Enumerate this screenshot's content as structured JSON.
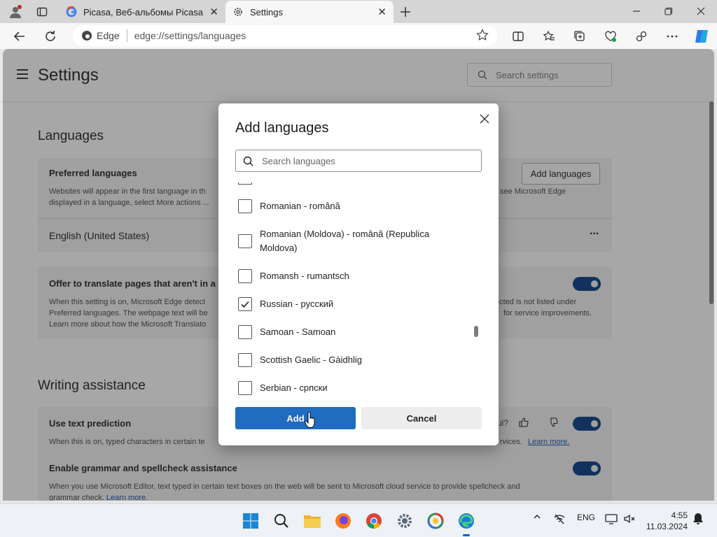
{
  "tabs": [
    {
      "title": "Picasa, Веб-альбомы Picasa и Al"
    },
    {
      "title": "Settings"
    }
  ],
  "address": {
    "site_label": "Edge",
    "url": "edge://settings/languages"
  },
  "settings": {
    "title": "Settings",
    "search_placeholder": "Search settings",
    "languages_heading": "Languages",
    "preferred": {
      "title": "Preferred languages",
      "desc_line1": "Websites will appear in the first language in th",
      "desc_line1b": "see Microsoft Edge",
      "desc_line2": "displayed in a language, select More actions ...",
      "add_button": "Add languages",
      "language": "English (United States)",
      "more": "..."
    },
    "translate": {
      "title": "Offer to translate pages that aren't in a",
      "line1": "When this setting is on, Microsoft Edge detect",
      "line1b": "ected is not listed under",
      "line2": "Preferred languages. The webpage text will be",
      "line2b": "for service improvements.",
      "line3": "Learn more about how the Microsoft Translato"
    },
    "writing_heading": "Writing assistance",
    "prediction": {
      "title": "Use text prediction",
      "question_tail": "ul?",
      "desc": "When this is on, typed characters in certain te",
      "desc_tail": "rvices.",
      "learn_more": "Learn more."
    },
    "grammar": {
      "title": "Enable grammar and spellcheck assistance",
      "line1": "When you use Microsoft Editor, text typed in certain text boxes on the web will be sent to Microsoft cloud service to provide spellcheck and",
      "line2": "grammar check.",
      "learn_more": "Learn more."
    }
  },
  "dialog": {
    "title": "Add languages",
    "search_placeholder": "Search languages",
    "items": [
      {
        "label": "Romanian - română",
        "checked": false
      },
      {
        "label": "Romanian (Moldova) - română (Republica",
        "label2": "Moldova)",
        "checked": false
      },
      {
        "label": "Romansh - rumantsch",
        "checked": false
      },
      {
        "label": "Russian - русский",
        "checked": true
      },
      {
        "label": "Samoan - Samoan",
        "checked": false
      },
      {
        "label": "Scottish Gaelic - Gàidhlig",
        "checked": false
      },
      {
        "label": "Serbian - српски",
        "checked": false
      }
    ],
    "add_label": "Add",
    "cancel_label": "Cancel"
  },
  "taskbar": {
    "lang": "ENG",
    "time": "4:55",
    "date": "11.03.2024"
  },
  "colors": {
    "accent": "#1f6cc0",
    "toggle_on": "#12315e",
    "win_blue": "#0067c0"
  }
}
